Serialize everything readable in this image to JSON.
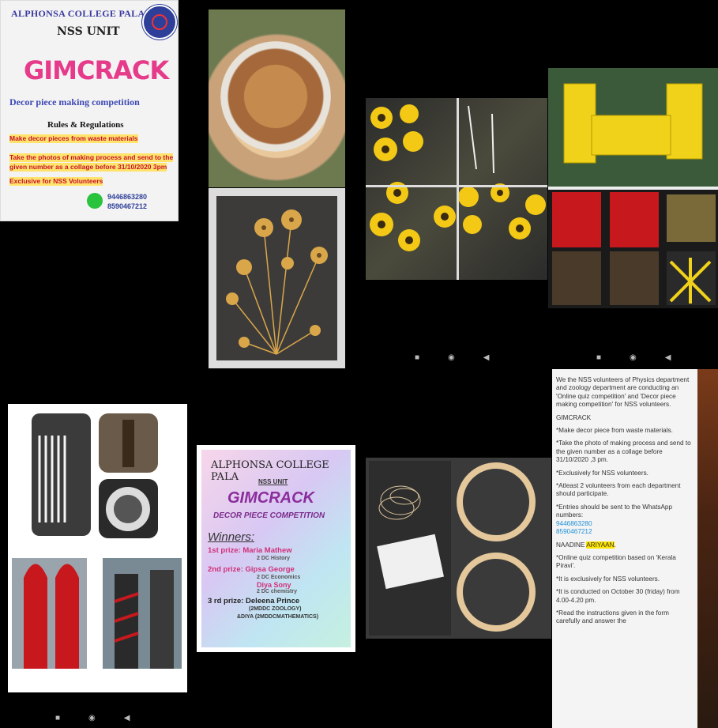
{
  "poster1": {
    "title": "ALPHONSA COLLEGE PALA",
    "unit": "NSS UNIT",
    "name": "GIMCRACK",
    "subtitle": "Decor piece making competition",
    "rules_title": "Rules & Regulations",
    "rules": [
      "Make decor pieces from waste materials",
      "Take the photos of making process and send to the",
      "given number as a collage before 31/10/2020 3pm",
      "Exclusive for NSS Volunteers"
    ],
    "phones": [
      "9446863280",
      "8590467212"
    ]
  },
  "poster2": {
    "title": "ALPHONSA COLLEGE PALA",
    "unit": "NSS UNIT",
    "name": "GIMCRACK",
    "subtitle": "DECOR PIECE COMPETITION",
    "winners_label": "Winners:",
    "first": "1st prize: Maria Mathew",
    "first_dept": "2 DC History",
    "second": "2nd prize: Gipsa George",
    "second_dept": "2 DC Economics",
    "second2": "Diya Sony",
    "second2_dept": "2 DC chemistry",
    "third": "3 rd prize: Deleena Prince",
    "third_dept": "(2MDDC ZOOLOGY)",
    "third2": "&DIYA (2MDDCMATHEMATICS)"
  },
  "message": {
    "intro": "We the NSS volunteers of Physics department and zoology department are conducting an 'Online quiz competition' and 'Decor piece making competition' for NSS volunteers.",
    "heading": "GIMCRACK",
    "items": [
      "*Make decor piece from waste materials.",
      "*Take the photo of making process and send to the given number as a collage before 31/10/2020 ,3 pm.",
      "*Exclusively for NSS volunteers.",
      "*Atleast 2 volunteers from each department should participate.",
      "*Entries should be sent to the WhatsApp numbers:"
    ],
    "phones": [
      "9446863280",
      "8590467212"
    ],
    "name_a": "NAADINE ",
    "name_b": "ARIYAAN",
    "name_c": ".",
    "items2": [
      "*Online quiz competition based on 'Kerala Piravi'.",
      "*It is exclusively for NSS volunteers.",
      "*It is conducted on October 30 (friday) from 4.00-4.20 pm.",
      "*Read the instructions given in the form carefully and answer the"
    ]
  },
  "nav": {
    "square": "■",
    "circle": "◉",
    "back": "◀"
  }
}
